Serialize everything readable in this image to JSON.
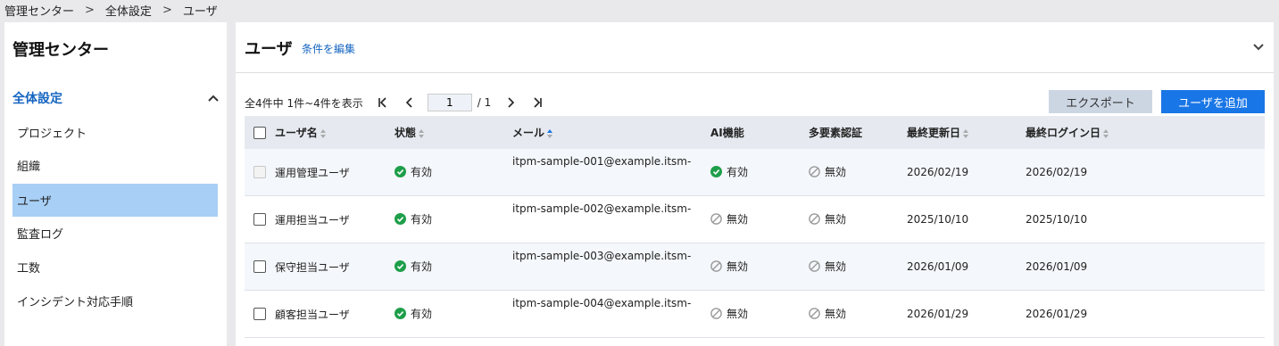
{
  "breadcrumb": [
    "管理センター",
    "全体設定",
    "ユーザ"
  ],
  "breadcrumb_separator": ">",
  "sidebar": {
    "title": "管理センター",
    "section": "全体設定",
    "items": [
      {
        "label": "プロジェクト",
        "active": false
      },
      {
        "label": "組織",
        "active": false
      },
      {
        "label": "ユーザ",
        "active": true
      },
      {
        "label": "監査ログ",
        "active": false
      },
      {
        "label": "工数",
        "active": false
      },
      {
        "label": "インシデント対応手順",
        "active": false
      }
    ]
  },
  "header": {
    "title": "ユーザ",
    "edit_link": "条件を編集"
  },
  "pager": {
    "summary": "全4件中 1件~4件を表示",
    "page": "1",
    "total": "/ 1"
  },
  "buttons": {
    "export": "エクスポート",
    "add_user": "ユーザを追加"
  },
  "table": {
    "columns": [
      "ユーザ名",
      "状態",
      "メール",
      "AI機能",
      "多要素認証",
      "最終更新日",
      "最終ログイン日"
    ],
    "rows": [
      {
        "name": "運用管理ユーザ",
        "status": "有効",
        "email": "itpm-sample-001@example.itsm-",
        "ai": "有効",
        "mfa": "無効",
        "updated": "2026/02/19",
        "last_login": "2026/02/19",
        "ai_on": true,
        "checkbox_disabled": true
      },
      {
        "name": "運用担当ユーザ",
        "status": "有効",
        "email": "itpm-sample-002@example.itsm-",
        "ai": "無効",
        "mfa": "無効",
        "updated": "2025/10/10",
        "last_login": "2025/10/10",
        "ai_on": false,
        "checkbox_disabled": false
      },
      {
        "name": "保守担当ユーザ",
        "status": "有効",
        "email": "itpm-sample-003@example.itsm-",
        "ai": "無効",
        "mfa": "無効",
        "updated": "2026/01/09",
        "last_login": "2026/01/09",
        "ai_on": false,
        "checkbox_disabled": false
      },
      {
        "name": "顧客担当ユーザ",
        "status": "有効",
        "email": "itpm-sample-004@example.itsm-",
        "ai": "無効",
        "mfa": "無効",
        "updated": "2026/01/29",
        "last_login": "2026/01/29",
        "ai_on": false,
        "checkbox_disabled": false
      }
    ]
  },
  "colors": {
    "accent": "#1976e6",
    "active_nav": "#a8cff5",
    "enabled_green": "#1e9e4a",
    "disabled_gray": "#9a9a9a"
  },
  "icons": {
    "enabled": "check-circle-icon",
    "disabled": "prohibited-icon",
    "sort_active": "sort-asc-icon",
    "sort_inactive": "sort-icon"
  }
}
